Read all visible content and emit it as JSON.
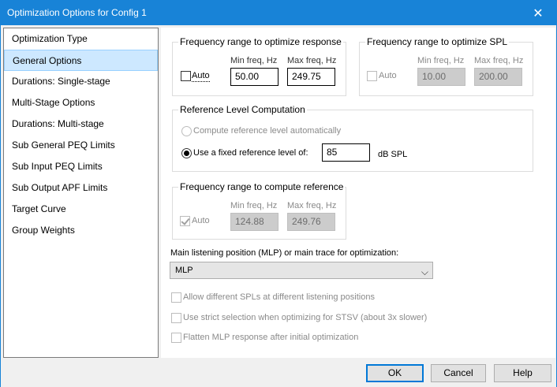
{
  "window": {
    "title": "Optimization Options for Config 1",
    "close_glyph": "✕"
  },
  "sidebar": {
    "items": [
      {
        "label": "Optimization Type"
      },
      {
        "label": "General Options"
      },
      {
        "label": "Durations: Single-stage"
      },
      {
        "label": "Multi-Stage Options"
      },
      {
        "label": "Durations: Multi-stage"
      },
      {
        "label": "Sub General PEQ Limits"
      },
      {
        "label": "Sub Input PEQ Limits"
      },
      {
        "label": "Sub Output APF Limits"
      },
      {
        "label": "Target Curve"
      },
      {
        "label": "Group Weights"
      }
    ],
    "selected": "General Options"
  },
  "freq_response": {
    "title": "Frequency range to optimize response",
    "auto_label": "Auto",
    "auto_checked": false,
    "min_label": "Min freq, Hz",
    "max_label": "Max freq, Hz",
    "min_value": "50.00",
    "max_value": "249.75"
  },
  "freq_spl": {
    "title": "Frequency range to optimize SPL",
    "auto_label": "Auto",
    "auto_checked": false,
    "min_label": "Min freq, Hz",
    "max_label": "Max freq, Hz",
    "min_value": "10.00",
    "max_value": "200.00"
  },
  "ref_level": {
    "title": "Reference Level Computation",
    "option_auto": "Compute reference level automatically",
    "option_fixed": "Use a fixed reference level of:",
    "selected": "fixed",
    "fixed_value": "85",
    "unit": "dB SPL"
  },
  "freq_ref": {
    "title": "Frequency range to compute reference",
    "auto_label": "Auto",
    "auto_checked": true,
    "min_label": "Min freq, Hz",
    "max_label": "Max freq, Hz",
    "min_value": "124.88",
    "max_value": "249.76"
  },
  "mlp": {
    "label": "Main listening position (MLP) or main trace for optimization:",
    "selected": "MLP"
  },
  "options": [
    {
      "label": "Allow different SPLs at different listening positions",
      "checked": false
    },
    {
      "label": "Use strict selection when optimizing for STSV (about 3x slower)",
      "checked": false
    },
    {
      "label": "Flatten MLP response after initial optimization",
      "checked": false
    }
  ],
  "buttons": {
    "ok": "OK",
    "cancel": "Cancel",
    "help": "Help"
  },
  "colors": {
    "titlebar": "#1883d7",
    "selection": "#cde8ff",
    "default_button_border": "#0078d7"
  }
}
